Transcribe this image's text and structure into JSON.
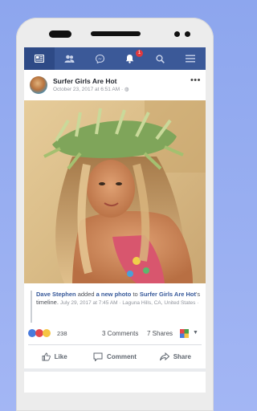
{
  "navbar": {
    "items": [
      {
        "icon": "news-feed-icon",
        "active": true
      },
      {
        "icon": "friends-icon",
        "active": false
      },
      {
        "icon": "messenger-icon",
        "active": false
      },
      {
        "icon": "notifications-icon",
        "active": false,
        "badge": "1"
      },
      {
        "icon": "search-icon",
        "active": false
      },
      {
        "icon": "menu-icon",
        "active": false
      }
    ]
  },
  "post": {
    "page_name": "Surfer Girls Are Hot",
    "time": "October 23, 2017 at 6:51 AM",
    "more": "•••",
    "shared": {
      "actor": "Dave Stephen",
      "verb": " added ",
      "object": "a new photo",
      "preposition": " to ",
      "target": "Surfer Girls Are Hot",
      "target_suffix": "'s timeline.",
      "meta": "July 29, 2017 at 7:45 AM · Laguna Hills, CA, United States ·"
    },
    "stats": {
      "reaction_count": "238",
      "comments": "3 Comments",
      "shares": "7 Shares"
    },
    "actions": {
      "like": "Like",
      "comment": "Comment",
      "share": "Share"
    }
  },
  "colors": {
    "facebook_blue": "#3b5998",
    "badge_red": "#e0393e",
    "link_blue": "#365899"
  }
}
